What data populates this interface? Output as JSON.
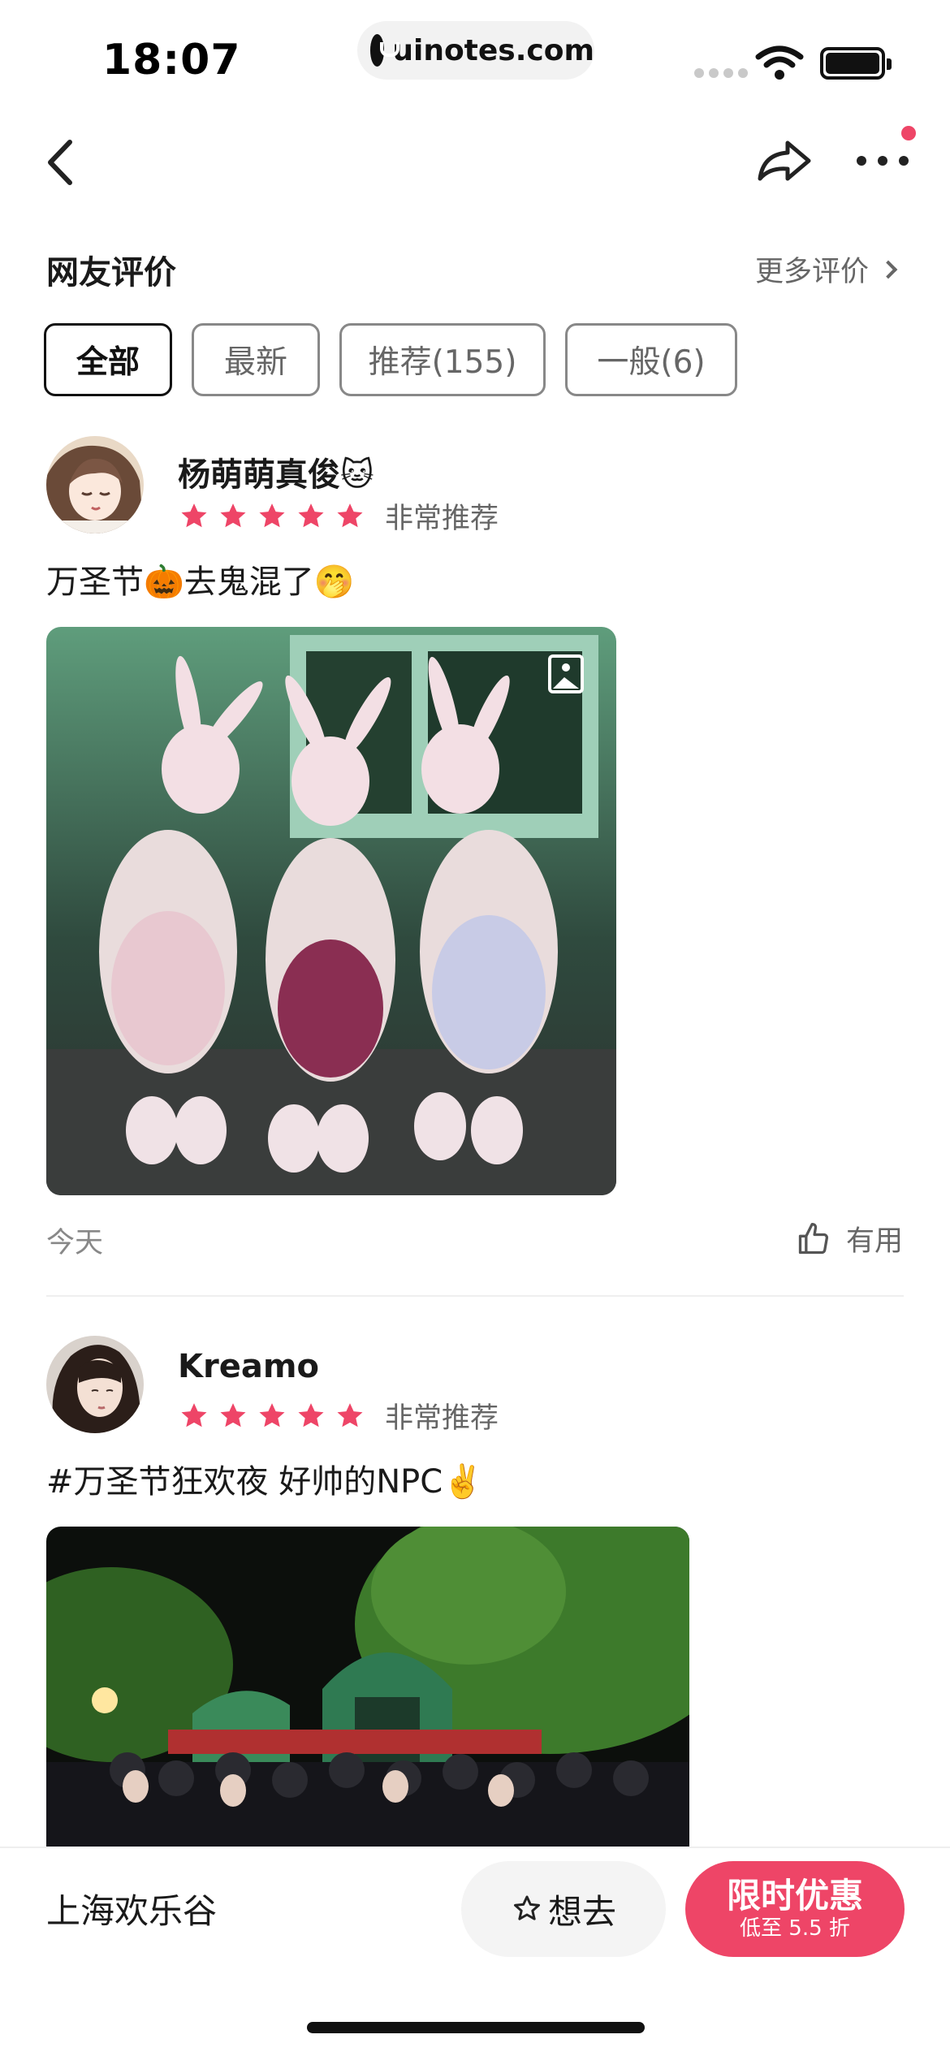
{
  "status_bar": {
    "time": "18:07",
    "url": "uinotes.com"
  },
  "section": {
    "title": "网友评价",
    "more_label": "更多评价"
  },
  "filters": [
    {
      "label": "全部",
      "active": true
    },
    {
      "label": "最新",
      "active": false
    },
    {
      "label": "推荐(155)",
      "active": false
    },
    {
      "label": "一般(6)",
      "active": false
    }
  ],
  "reviews": [
    {
      "username": "杨萌萌真俊🐱",
      "rating": 5,
      "rating_text": "非常推荐",
      "text": "万圣节🎃去鬼混了🤭",
      "date": "今天",
      "helpful_label": "有用"
    },
    {
      "username": "Kreamo",
      "rating": 5,
      "rating_text": "非常推荐",
      "text": "#万圣节狂欢夜 好帅的NPC✌️"
    }
  ],
  "bottom_bar": {
    "park_name": "上海欢乐谷",
    "want_label": "想去",
    "deal_title": "限时优惠",
    "deal_subtitle": "低至 5.5 折"
  },
  "colors": {
    "accent": "#ee4567",
    "text_primary": "#1a1a1a",
    "text_secondary": "#666666"
  },
  "icons": [
    "back-icon",
    "share-icon",
    "more-icon",
    "star-icon",
    "thumbs-up-icon",
    "image-icon",
    "chevron-right-icon",
    "star-outline-icon"
  ]
}
